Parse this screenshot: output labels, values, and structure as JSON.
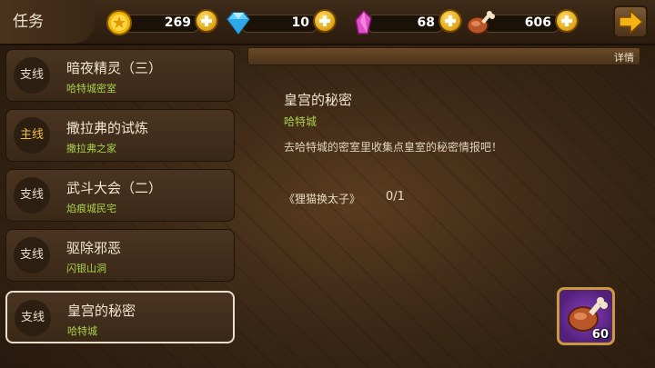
{
  "header": {
    "title": "任务",
    "resources": [
      {
        "name": "coin",
        "icon": "coin-icon",
        "value": "269"
      },
      {
        "name": "diamond",
        "icon": "diamond-icon",
        "value": "10"
      },
      {
        "name": "crystal",
        "icon": "crystal-icon",
        "value": "68"
      },
      {
        "name": "meat",
        "icon": "meat-icon",
        "value": "606"
      }
    ]
  },
  "quests": [
    {
      "type": "支线",
      "name": "暗夜精灵（三）",
      "location": "哈特城密室"
    },
    {
      "type": "主线",
      "name": "撒拉弗的试炼",
      "location": "撒拉弗之家"
    },
    {
      "type": "支线",
      "name": "武斗大会（二）",
      "location": "焰痕城民宅"
    },
    {
      "type": "支线",
      "name": "驱除邪恶",
      "location": "闪银山洞"
    },
    {
      "type": "支线",
      "name": "皇宫的秘密",
      "location": "哈特城"
    }
  ],
  "detail": {
    "banner_label": "详情",
    "title": "皇宫的秘密",
    "location": "哈特城",
    "description": "去哈特城的密室里收集点皇室的秘密情报吧！",
    "objective": "《狸猫换太子》",
    "progress": "0/1",
    "reward": {
      "icon": "meat-icon",
      "count": "60"
    }
  },
  "colors": {
    "location_green": "#a8d34a",
    "main_quest_gold": "#f0c040",
    "reward_purple": "#8a3fc0"
  }
}
